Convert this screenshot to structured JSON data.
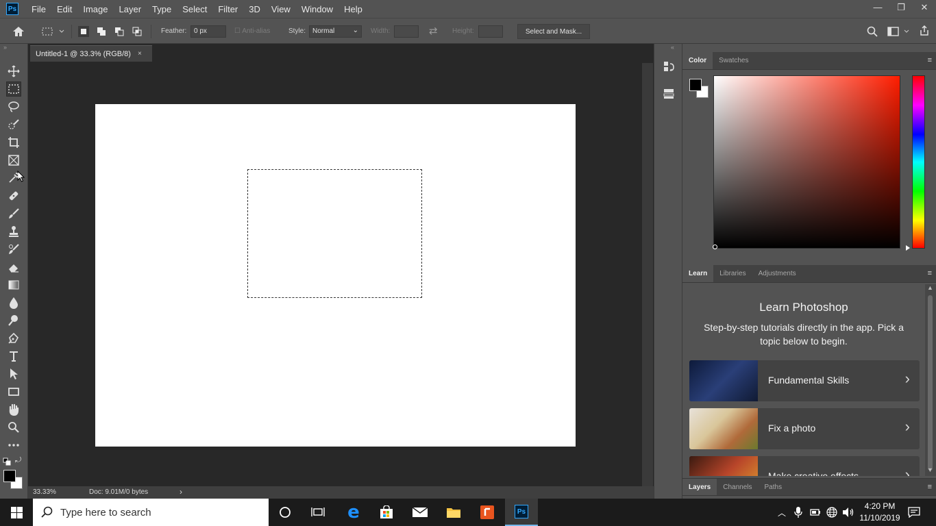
{
  "app": {
    "logo": "Ps"
  },
  "menu": [
    "File",
    "Edit",
    "Image",
    "Layer",
    "Type",
    "Select",
    "Filter",
    "3D",
    "View",
    "Window",
    "Help"
  ],
  "window_controls": {
    "minimize": "—",
    "restore": "❐",
    "close": "✕"
  },
  "options": {
    "feather_label": "Feather:",
    "feather_value": "0 px",
    "antialias_label": "Anti-alias",
    "style_label": "Style:",
    "style_value": "Normal",
    "width_label": "Width:",
    "height_label": "Height:",
    "select_mask_label": "Select and Mask..."
  },
  "document": {
    "tab_title": "Untitled-1 @ 33.3% (RGB/8)",
    "tab_close": "×",
    "zoom": "33.33%",
    "doc_info": "Doc: 9.01M/0 bytes",
    "status_arrow": "›"
  },
  "tools": [
    "move-tool",
    "marquee-tool",
    "lasso-tool",
    "quick-selection-tool",
    "crop-tool",
    "frame-tool",
    "eyedropper-tool",
    "healing-brush-tool",
    "brush-tool",
    "clone-stamp-tool",
    "history-brush-tool",
    "eraser-tool",
    "gradient-tool",
    "blur-tool",
    "dodge-tool",
    "pen-tool",
    "type-tool",
    "path-selection-tool",
    "rectangle-tool",
    "hand-tool",
    "zoom-tool",
    "more-tools"
  ],
  "color_panel": {
    "tabs": [
      "Color",
      "Swatches"
    ],
    "active_tab": "Color",
    "foreground": "#000000",
    "background": "#ffffff",
    "hue": "#ff1d00"
  },
  "learn_panel": {
    "tabs": [
      "Learn",
      "Libraries",
      "Adjustments"
    ],
    "active_tab": "Learn",
    "title": "Learn Photoshop",
    "subtitle": "Step-by-step tutorials directly in the app. Pick a topic below to begin.",
    "cards": [
      {
        "label": "Fundamental Skills"
      },
      {
        "label": "Fix a photo"
      },
      {
        "label": "Make creative effects"
      }
    ],
    "chevron": "›"
  },
  "layers_panel": {
    "tabs": [
      "Layers",
      "Channels",
      "Paths"
    ],
    "active_tab": "Layers"
  },
  "taskbar": {
    "search_placeholder": "Type here to search",
    "time": "4:20 PM",
    "date": "11/10/2019"
  }
}
